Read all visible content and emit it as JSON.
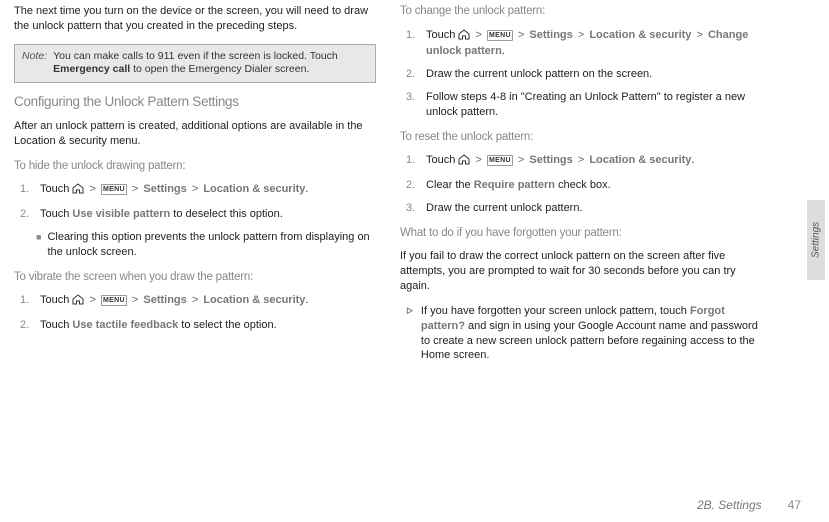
{
  "left": {
    "intro": "The next time you turn on the device or the screen, you will need to draw the unlock pattern that you created in the preceding steps.",
    "note_label": "Note:",
    "note_text_a": "You can make calls to 911 even if the screen is locked. Touch ",
    "note_bold": "Emergency call",
    "note_text_b": " to open the Emergency Dialer screen.",
    "h_config": "Configuring the Unlock Pattern Settings",
    "p_config": "After an unlock pattern is created, additional options are available in the Location & security menu.",
    "h_hide": "To hide the unlock drawing pattern:",
    "hide1_a": "Touch ",
    "hide1_b": "Settings",
    "hide1_c": "Location & security",
    "hide2_a": "Touch ",
    "hide2_bold": "Use visible pattern",
    "hide2_b": " to deselect this option.",
    "hide_sub": "Clearing this option prevents the unlock pattern from displaying on the unlock screen.",
    "h_vibrate": "To vibrate the screen when you draw the pattern:",
    "vib1_a": "Touch ",
    "vib1_b": "Settings",
    "vib1_c": "Location & security",
    "vib2_a": "Touch ",
    "vib2_bold": "Use tactile feedback",
    "vib2_b": " to select the option.",
    "menu_text": "MENU"
  },
  "right": {
    "h_change": "To change the unlock pattern:",
    "ch1_a": "Touch ",
    "ch1_b": "Settings",
    "ch1_c": "Location & security",
    "ch1_d": "Change unlock pattern",
    "ch2": "Draw the current unlock pattern on the screen.",
    "ch3": "Follow steps 4-8 in \"Creating an Unlock Pattern\" to register a new unlock pattern.",
    "h_reset": "To reset the unlock pattern:",
    "rs1_a": "Touch ",
    "rs1_b": "Settings",
    "rs1_c": "Location & security",
    "rs2_a": "Clear the ",
    "rs2_bold": "Require pattern",
    "rs2_b": " check box.",
    "rs3": "Draw the current unlock pattern.",
    "h_forgot": "What to do if you have forgotten your pattern:",
    "forgot_p": "If you fail to draw the correct unlock pattern on the screen after five attempts, you are prompted to wait for 30 seconds before you can try again.",
    "forgot_item_a": "If you have forgotten your screen unlock pattern, touch ",
    "forgot_bold": "Forgot pattern?",
    "forgot_item_b": " and sign in using your Google Account name and password to create a new screen unlock pattern before regaining access to the Home screen.",
    "menu_text": "MENU"
  },
  "numbers": {
    "n1": "1.",
    "n2": "2.",
    "n3": "3."
  },
  "side": "Settings",
  "footer": {
    "section": "2B. Settings",
    "page": "47"
  }
}
